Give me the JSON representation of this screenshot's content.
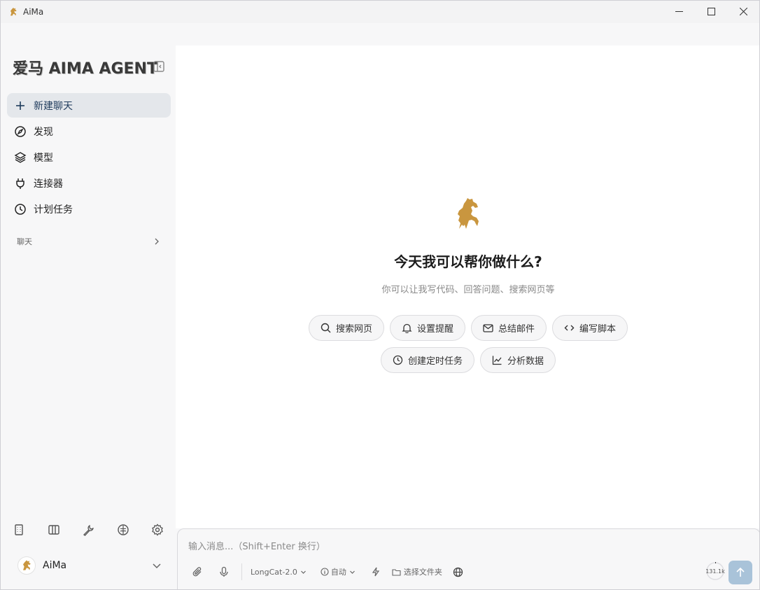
{
  "window": {
    "title": "AiMa"
  },
  "sidebar": {
    "brand": "爱马 AIMA AGENT",
    "nav": [
      {
        "label": "新建聊天",
        "icon": "plus-icon"
      },
      {
        "label": "发现",
        "icon": "compass-icon"
      },
      {
        "label": "模型",
        "icon": "layers-icon"
      },
      {
        "label": "连接器",
        "icon": "plug-icon"
      },
      {
        "label": "计划任务",
        "icon": "clock-icon"
      }
    ],
    "section_label": "聊天",
    "bottom_tools": [
      "building-icon",
      "columns-icon",
      "wrench-icon",
      "brain-icon",
      "gear-icon"
    ],
    "user": {
      "name": "AiMa"
    }
  },
  "main": {
    "title": "今天我可以帮你做什么?",
    "subtitle": "你可以让我写代码、回答问题、搜索网页等",
    "chips": [
      {
        "label": "搜索网页",
        "icon": "search-icon"
      },
      {
        "label": "设置提醒",
        "icon": "bell-icon"
      },
      {
        "label": "总结邮件",
        "icon": "mail-icon"
      },
      {
        "label": "编写脚本",
        "icon": "code-icon"
      },
      {
        "label": "创建定时任务",
        "icon": "clock-icon"
      },
      {
        "label": "分析数据",
        "icon": "chart-line-icon"
      }
    ]
  },
  "composer": {
    "placeholder": "输入消息...（Shift+Enter 换行）",
    "model": "LongCat-2.0",
    "mode": "自动",
    "folder_label": "选择文件夹",
    "token_count": "131.1k"
  },
  "colors": {
    "accent": "#a9c3d9",
    "active_nav_bg": "#e4e7eb",
    "brand_gold": "#c9963f"
  }
}
